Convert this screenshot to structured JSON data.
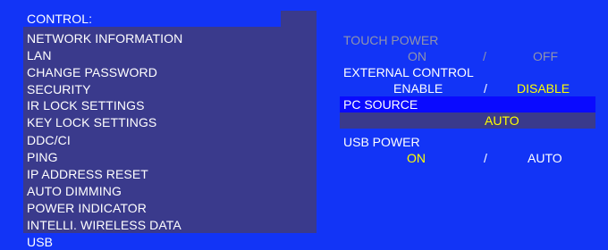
{
  "menu": {
    "header": "CONTROL:",
    "items": [
      "NETWORK INFORMATION",
      "LAN",
      "CHANGE PASSWORD",
      "SECURITY",
      "IR LOCK SETTINGS",
      "KEY LOCK SETTINGS",
      "DDC/CI",
      "PING",
      "IP ADDRESS RESET",
      "AUTO DIMMING",
      "POWER INDICATOR",
      "INTELLI. WIRELESS DATA"
    ],
    "selected": "USB"
  },
  "settings": {
    "touch_power": {
      "label": "TOUCH POWER",
      "on": "ON",
      "sep": "/",
      "off": "OFF"
    },
    "external_control": {
      "label": "EXTERNAL CONTROL",
      "enable": "ENABLE",
      "sep": "/",
      "disable": "DISABLE"
    },
    "pc_source": {
      "label": "PC SOURCE",
      "value": "AUTO"
    },
    "usb_power": {
      "label": "USB POWER",
      "on": "ON",
      "sep": "/",
      "auto": "AUTO"
    }
  },
  "colors": {
    "background": "#1234f6",
    "panel": "#3a3a8c",
    "highlight": "#0a0aff",
    "selected_value": "#ffff00",
    "disabled_text": "#8f94ad"
  }
}
